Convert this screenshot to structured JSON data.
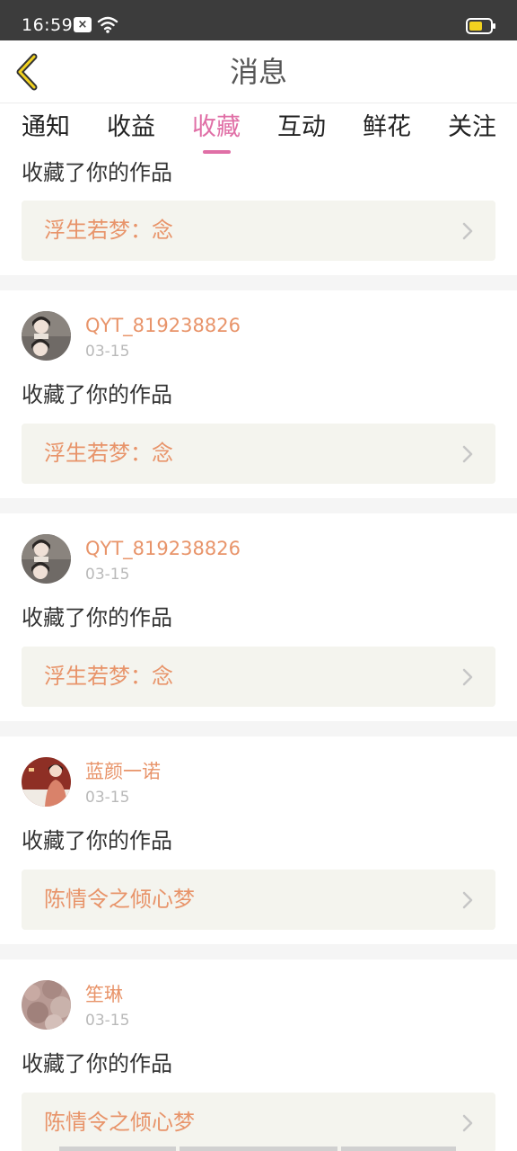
{
  "status_bar": {
    "time": "16:59",
    "notification_glyph": "×",
    "icons": [
      "notification-icon",
      "wifi-icon",
      "battery-icon"
    ],
    "battery_color": "#f2d21f"
  },
  "header": {
    "back_icon": "chevron-left-icon",
    "title": "消息"
  },
  "tabs": [
    {
      "label": "通知",
      "active": false
    },
    {
      "label": "收益",
      "active": false
    },
    {
      "label": "收藏",
      "active": true
    },
    {
      "label": "互动",
      "active": false
    },
    {
      "label": "鲜花",
      "active": false
    },
    {
      "label": "关注",
      "active": false
    }
  ],
  "colors": {
    "accent": "#e06fa6",
    "username": "#e8946a",
    "card_bg": "#f4f4ee"
  },
  "feed": {
    "partial_top": {
      "action": "收藏了你的作品",
      "work_title": "浮生若梦：念"
    },
    "items": [
      {
        "username": "QYT_819238826",
        "date": "03-15",
        "action": "收藏了你的作品",
        "work_title": "浮生若梦：念"
      },
      {
        "username": "QYT_819238826",
        "date": "03-15",
        "action": "收藏了你的作品",
        "work_title": "浮生若梦：念"
      },
      {
        "username": "蓝颜一诺",
        "date": "03-15",
        "action": "收藏了你的作品",
        "work_title": "陈情令之倾心梦"
      },
      {
        "username": "笙琳",
        "date": "03-15",
        "action": "收藏了你的作品",
        "work_title": "陈情令之倾心梦"
      }
    ]
  }
}
